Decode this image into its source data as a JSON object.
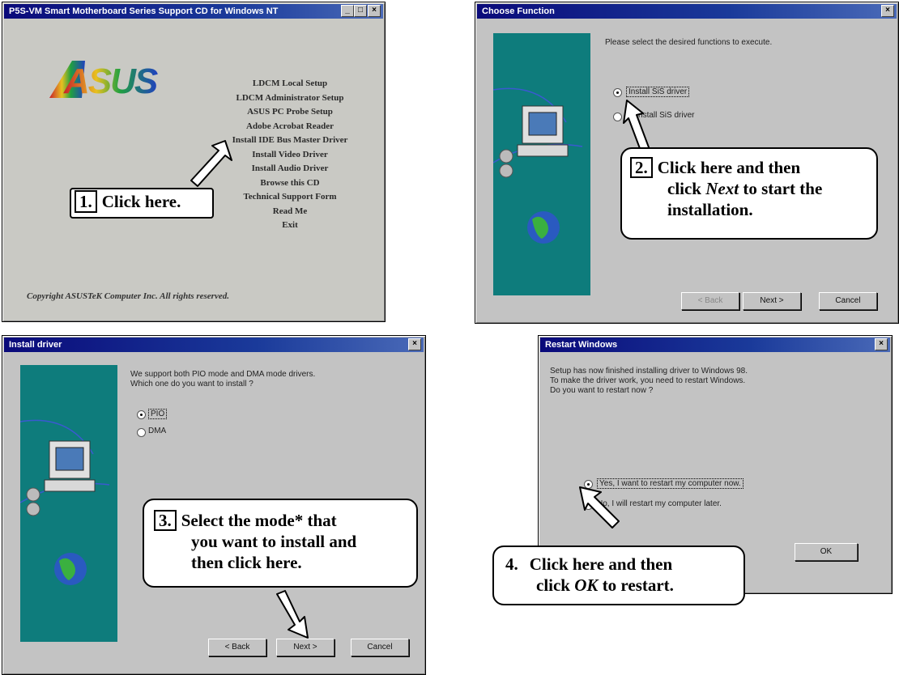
{
  "panel1": {
    "title": "P5S-VM Smart Motherboard Series Support CD for Windows NT",
    "logo": "ASUS",
    "menu_items": [
      "LDCM Local Setup",
      "LDCM Administrator Setup",
      "ASUS PC Probe Setup",
      "Adobe Acrobat Reader",
      "Install IDE Bus Master Driver",
      "Install Video Driver",
      "Install Audio Driver",
      "Browse this CD",
      "Technical Support Form",
      "Read Me",
      "Exit"
    ],
    "copyright": "Copyright ASUSTeK Computer Inc. All rights reserved.",
    "callout_num": "1.",
    "callout_text": "Click here."
  },
  "panel2": {
    "title": "Choose Function",
    "prompt": "Please select the desired functions to execute.",
    "options": [
      "Install SiS driver",
      "Uninstall SiS driver"
    ],
    "buttons": {
      "back": "< Back",
      "next": "Next >",
      "cancel": "Cancel"
    },
    "callout_num": "2.",
    "callout_line1": "Click here and then",
    "callout_line2a": "click ",
    "callout_line2b": "Next",
    "callout_line2c": " to start the",
    "callout_line3": "installation."
  },
  "panel3": {
    "title": "Install driver",
    "prompt_line1": "We support both PIO mode and DMA mode drivers.",
    "prompt_line2": "Which one do you want to install ?",
    "options": [
      "PIO",
      "DMA"
    ],
    "buttons": {
      "back": "< Back",
      "next": "Next >",
      "cancel": "Cancel"
    },
    "callout_num": "3.",
    "callout_line1": "Select the mode* that",
    "callout_line2": "you want to install and",
    "callout_line3": "then click here."
  },
  "panel4": {
    "title": "Restart Windows",
    "text_line1": "Setup has now finished installing driver to Windows 98.",
    "text_line2": "To make the driver work, you need to restart Windows.",
    "text_line3": "Do you want to restart now ?",
    "options": [
      "Yes, I want to restart my computer now.",
      "No, I will restart my computer later."
    ],
    "ok_label": "OK",
    "callout_num": "4.",
    "callout_line1": "Click here and then",
    "callout_line2a": "click ",
    "callout_line2b": "OK",
    "callout_line2c": " to restart."
  },
  "colors": {
    "teal": "#0e7c7c",
    "titlebar": "#0a0a7a",
    "dialog": "#c3c3c3"
  }
}
